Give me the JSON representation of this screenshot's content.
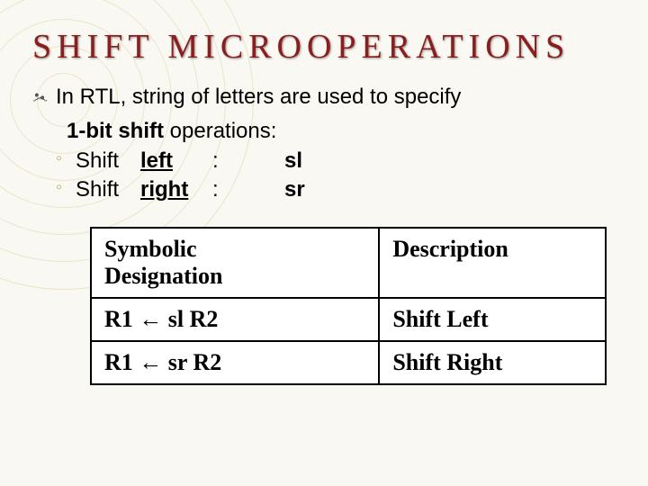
{
  "title": "SHIFT  MICROOPERATIONS",
  "bullet_icon": "٭",
  "body": {
    "line1_pre": "In RTL, string of letters are used to specify",
    "line2_pre": "1-bit shift",
    "line2_post": " operations:",
    "sub_mark": "◦",
    "shift_left_label": "Shift ",
    "shift_left_word": "left",
    "shift_right_label": "Shift ",
    "shift_right_word": "right",
    "colon": ":",
    "sl": "sl",
    "sr": "sr"
  },
  "table": {
    "header_sym_line1": "Symbolic",
    "header_sym_line2": "Designation",
    "header_desc": "Description",
    "rows": [
      {
        "sym": "R1 ← sl R2",
        "desc": "Shift Left"
      },
      {
        "sym": "R1 ← sr R2",
        "desc": "Shift Right"
      }
    ]
  }
}
